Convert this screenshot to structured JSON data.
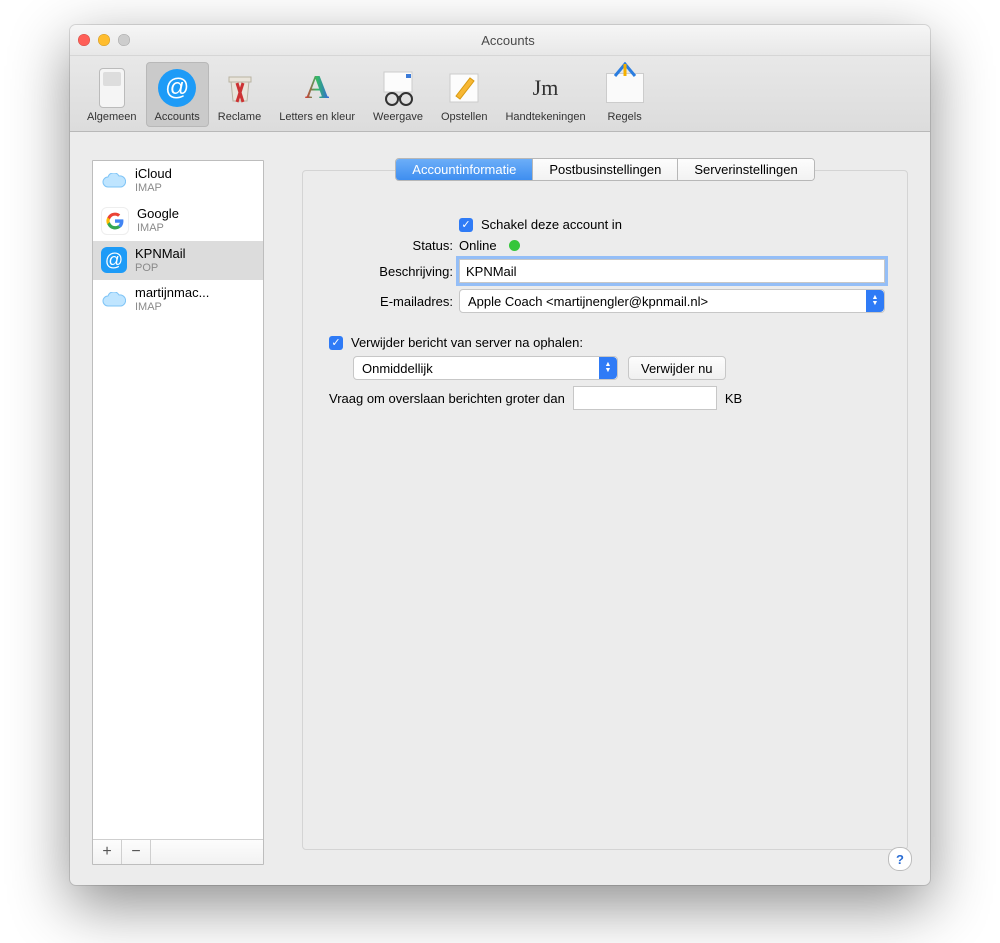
{
  "window": {
    "title": "Accounts"
  },
  "toolbar": {
    "items": [
      {
        "label": "Algemeen"
      },
      {
        "label": "Accounts",
        "selected": true
      },
      {
        "label": "Reclame"
      },
      {
        "label": "Letters en kleur"
      },
      {
        "label": "Weergave"
      },
      {
        "label": "Opstellen"
      },
      {
        "label": "Handtekeningen"
      },
      {
        "label": "Regels"
      }
    ]
  },
  "sidebar": {
    "accounts": [
      {
        "name": "iCloud",
        "type": "IMAP"
      },
      {
        "name": "Google",
        "type": "IMAP"
      },
      {
        "name": "KPNMail",
        "type": "POP",
        "selected": true
      },
      {
        "name": "martijnmac...",
        "type": "IMAP"
      }
    ]
  },
  "tabs": {
    "account_info": "Accountinformatie",
    "mailbox": "Postbusinstellingen",
    "server": "Serverinstellingen"
  },
  "form": {
    "enable_label": "Schakel deze account in",
    "status_label": "Status:",
    "status_value": "Online",
    "description_label": "Beschrijving:",
    "description_value": "KPNMail",
    "email_label": "E-mailadres:",
    "email_value": "Apple Coach <martijnengler@kpnmail.nl>",
    "remove_label": "Verwijder bericht van server na ophalen:",
    "remove_timing": "Onmiddellijk",
    "remove_now": "Verwijder nu",
    "skip_label": "Vraag om overslaan berichten groter dan",
    "skip_value": "",
    "kb": "KB"
  }
}
